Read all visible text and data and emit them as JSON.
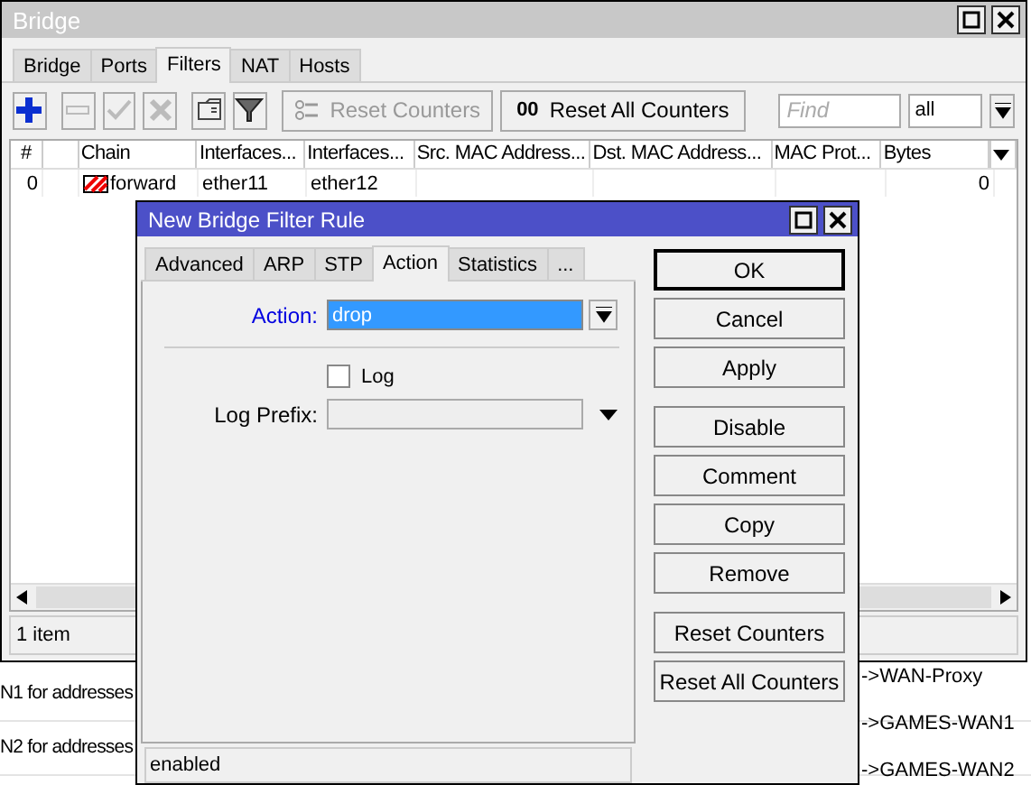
{
  "background_list": {
    "left_texts": [
      "N1 for addresses",
      "N2 for addresses"
    ],
    "right_texts": [
      "->WAN-Proxy",
      "->GAMES-WAN1",
      "->GAMES-WAN2"
    ]
  },
  "window": {
    "title": "Bridge",
    "tabs": [
      {
        "label": "Bridge",
        "selected": false
      },
      {
        "label": "Ports",
        "selected": false
      },
      {
        "label": "Filters",
        "selected": true
      },
      {
        "label": "NAT",
        "selected": false
      },
      {
        "label": "Hosts",
        "selected": false
      }
    ],
    "toolbar": {
      "icons": [
        {
          "kind": "add",
          "disabled": false
        },
        {
          "kind": "remove",
          "disabled": true
        },
        {
          "kind": "enable",
          "disabled": true
        },
        {
          "kind": "disable",
          "disabled": true
        },
        {
          "kind": "comment",
          "disabled": false
        },
        {
          "kind": "filter",
          "disabled": false
        }
      ],
      "reset_counters": {
        "label": "Reset Counters",
        "disabled": true
      },
      "reset_all_counters": {
        "icon_text": "00",
        "label": "Reset All Counters",
        "disabled": false
      },
      "find": {
        "placeholder": "Find"
      },
      "select": {
        "value": "all"
      }
    },
    "table": {
      "columns": [
        "#",
        "Chain",
        "Interfaces...",
        "Interfaces...",
        "Src. MAC Address...",
        "Dst. MAC Address...",
        "MAC Prot...",
        "Bytes"
      ],
      "rows": [
        {
          "number": "0",
          "chain": "forward",
          "in_interface": "ether11",
          "out_interface": "ether12",
          "bytes": "0"
        }
      ]
    },
    "status_bar": "1 item"
  },
  "dialog": {
    "title": "New Bridge Filter Rule",
    "tabs": [
      {
        "label": "Advanced",
        "selected": false
      },
      {
        "label": "ARP",
        "selected": false
      },
      {
        "label": "STP",
        "selected": false
      },
      {
        "label": "Action",
        "selected": true
      },
      {
        "label": "Statistics",
        "selected": false
      },
      {
        "label": "...",
        "selected": false
      }
    ],
    "action": {
      "label": "Action:",
      "value": "drop"
    },
    "log": {
      "label": "Log",
      "checked": false
    },
    "log_prefix": {
      "label": "Log Prefix:"
    },
    "button_groups": [
      [
        {
          "label": "OK",
          "default": true
        },
        {
          "label": "Cancel",
          "default": false
        },
        {
          "label": "Apply",
          "default": false
        }
      ],
      [
        {
          "label": "Disable",
          "default": false
        },
        {
          "label": "Comment",
          "default": false
        },
        {
          "label": "Copy",
          "default": false
        },
        {
          "label": "Remove",
          "default": false
        }
      ],
      [
        {
          "label": "Reset Counters",
          "default": false
        },
        {
          "label": "Reset All Counters",
          "default": false
        }
      ]
    ],
    "status": "enabled"
  }
}
